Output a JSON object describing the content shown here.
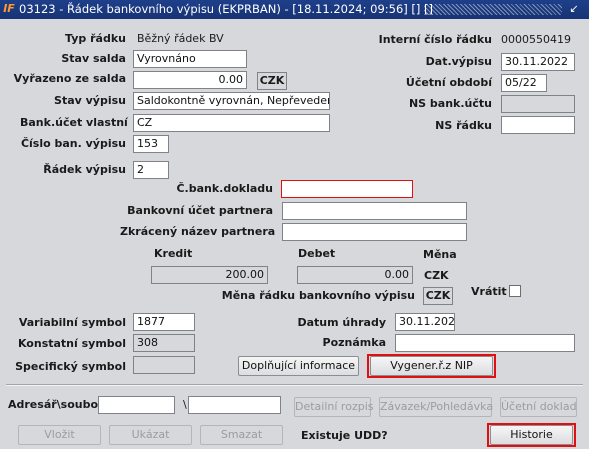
{
  "window": {
    "title": "03123 - Řádek bankovního výpisu (EKPRBAN) - [18.11.2024; 09:56] [] []",
    "logo": "IF",
    "restore_glyph": "↙",
    "close_glyph": "✕"
  },
  "left": {
    "typ_radku_label": "Typ řádku",
    "typ_radku_value": "Běžný řádek BV",
    "stav_salda_label": "Stav salda",
    "stav_salda_value": "Vyrovnáno",
    "vyrazeno_label": "Vyřazeno ze salda",
    "vyrazeno_value": "0.00",
    "vyrazeno_currency": "CZK",
    "stav_vypisu_label": "Stav výpisu",
    "stav_vypisu_value": "Saldokontně vyrovnán, Nepřevedeno",
    "bank_ucet_label": "Bank.účet vlastní",
    "bank_ucet_value": "CZ",
    "cislo_vypisu_label": "Číslo ban. výpisu",
    "cislo_vypisu_value": "153",
    "radek_vypisu_label": "Řádek výpisu",
    "radek_vypisu_value": "2"
  },
  "right": {
    "interni_cislo_label": "Interní číslo řádku",
    "interni_cislo_value": "0000550419",
    "dat_vypisu_label": "Dat.výpisu",
    "dat_vypisu_value": "30.11.2022",
    "ucetni_obdobi_label": "Účetní období",
    "ucetni_obdobi_value": "05/22",
    "ns_bank_uctu_label": "NS bank.účtu",
    "ns_bank_uctu_value": "",
    "ns_radku_label": "NS řádku",
    "ns_radku_value": ""
  },
  "partner": {
    "cbank_dokladu_label": "Č.bank.dokladu",
    "cbank_dokladu_value": "",
    "bank_ucet_partnera_label": "Bankovní účet partnera",
    "bank_ucet_partnera_value": "",
    "zkraceny_nazev_label": "Zkrácený název partnera",
    "zkraceny_nazev_value": ""
  },
  "amounts": {
    "kredit_label": "Kredit",
    "kredit_value": "200.00",
    "debet_label": "Debet",
    "debet_value": "0.00",
    "mena_label": "Měna",
    "mena_value": "CZK",
    "mena_radku_label": "Měna řádku bankovního výpisu",
    "mena_radku_value": "CZK",
    "vratit_label": "Vrátit",
    "vratit_checked": false
  },
  "symbols": {
    "variabilni_label": "Variabilní symbol",
    "variabilni_value": "1877",
    "konstantni_label": "Konstatní symbol",
    "konstantni_value": "308",
    "specificky_label": "Specifický symbol",
    "specificky_value": "",
    "datum_uhrady_label": "Datum úhrady",
    "datum_uhrady_value": "30.11.2022",
    "poznamka_label": "Poznámka",
    "poznamka_value": ""
  },
  "actions": {
    "doplnujici_label": "Doplňující informace",
    "vygener_label": "Vygener.ř.z NIP"
  },
  "footer": {
    "adresar_label": "Adresář\\soubor",
    "adresar_value": "",
    "slash": "\\",
    "soubor_value": "",
    "detailni_rozpis_label": "Detailní rozpis",
    "zavazek_label": "Závazek/Pohledávka",
    "ucetni_doklad_label": "Účetní doklad",
    "vlozit_label": "Vložit",
    "ukazat_label": "Ukázat",
    "smazat_label": "Smazat",
    "existuje_udd_label": "Existuje UDD?",
    "historie_label": "Historie"
  },
  "colors": {
    "title_bar": "#1e3f8a",
    "background": "#d6d8dc",
    "highlight_red": "#e01010",
    "logo_orange": "#ff9a2e"
  }
}
